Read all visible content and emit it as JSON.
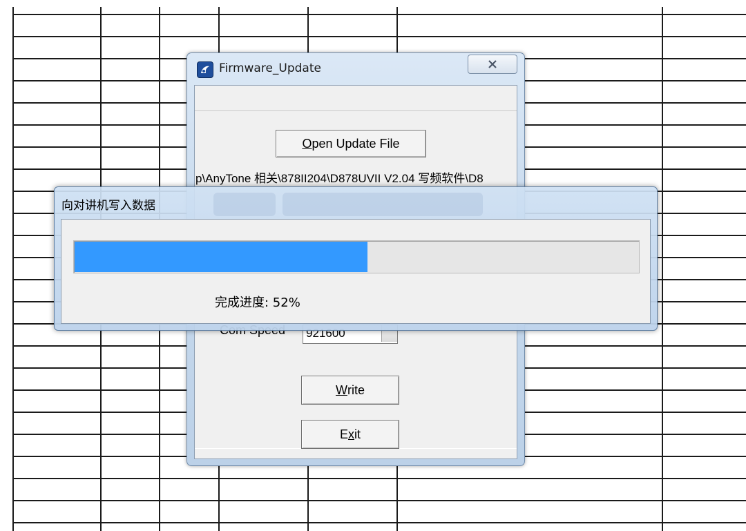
{
  "firmware_window": {
    "title": "Firmware_Update",
    "open_button_label": "Open Update File",
    "open_button_mnemonic": "O",
    "file_path": "p\\AnyTone 相关\\878II204\\D878UVII V2.04 写频软件\\D8",
    "com_speed_label": "Com Speed",
    "com_speed_value": "921600",
    "write_button_mnemonic": "W",
    "write_button_rest": "rite",
    "exit_button_pre": "E",
    "exit_button_mnemonic": "x",
    "exit_button_rest": "it"
  },
  "progress_dialog": {
    "title": "向对讲机写入数据",
    "progress_label": "完成进度: 52%",
    "progress_percent": 52,
    "fill_color": "#3399ff"
  },
  "icons": {
    "app_icon": "anytone-app-icon",
    "close_icon": "close-x-icon"
  }
}
